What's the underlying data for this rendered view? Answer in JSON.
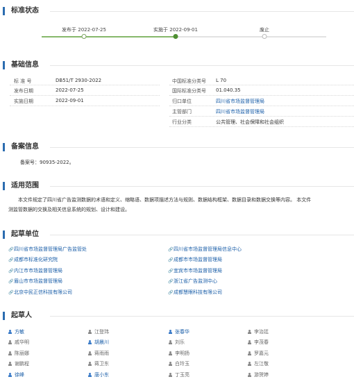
{
  "sections": {
    "status": "标准状态",
    "basic": "基础信息",
    "record": "备案信息",
    "scope": "适用范围",
    "drafting_units": "起草单位",
    "drafters": "起草人"
  },
  "timeline": {
    "published": "发布于 2022-07-25",
    "implemented": "实施于 2022-09-01",
    "abolished": "废止",
    "progress": 0.47
  },
  "basic": {
    "std_no_label": "标 准 号",
    "std_no": "DB51/T 2930-2022",
    "pub_date_label": "发布日期",
    "pub_date": "2022-07-25",
    "impl_date_label": "实施日期",
    "impl_date": "2022-09-01",
    "ccs_label": "中国标准分类号",
    "ccs": "L 70",
    "ics_label": "国际标准分类号",
    "ics": "01.040.35",
    "owner_label": "归口单位",
    "owner": "四川省市场监督管理局",
    "authority_label": "主管部门",
    "authority": "四川省市场监督管理局",
    "industry_label": "行业分类",
    "industry": "公共管理、社会保障和社会组织"
  },
  "record": {
    "text": "备案号：90935-2022。"
  },
  "scope": {
    "line1": "本文件规定了四川省广告监测数据的术语和定义、缩略语、数据项描述方法与规则、数据结构框架、数据目录和数据交换等内容。 本文件",
    "line2": "测监管数据的交换及相关信息系统的规划、设计和建设。"
  },
  "units": [
    "四川省市场监督管理局广告监管处",
    "四川省市场监督管理局信息中心",
    "成都市标准化研究院",
    "成都市市场监督管理局",
    "内江市市场监督管理局",
    "宜宾市市场监督管理局",
    "眉山市市场监督管理局",
    "浙江省广告监测中心",
    "北京中民正信科技有限公司",
    "成都慧眼科技有限公司"
  ],
  "drafters": [
    [
      "方敏",
      "江登玮",
      "张春华",
      "李治廷"
    ],
    [
      "戚华明",
      "胡晨川",
      "刘乐",
      "李茂春"
    ],
    [
      "陈丽娜",
      "蒋雨雨",
      "李明扬",
      "罗嘉元"
    ],
    [
      "谢鹏程",
      "蒋卫东",
      "白玲玉",
      "左江敬"
    ],
    [
      "徐峰",
      "唐小东",
      "丁玉亮",
      "游贺婷"
    ]
  ],
  "drafter_colors": {
    "link": "#1a5ea8",
    "plain": "#666666"
  }
}
